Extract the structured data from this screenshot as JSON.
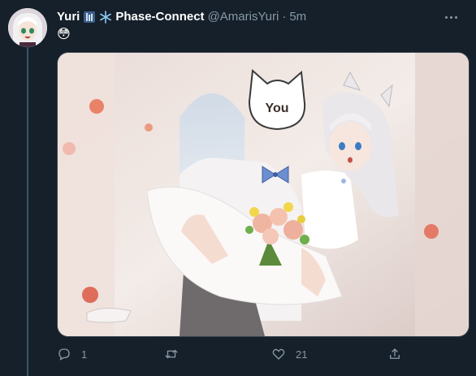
{
  "tweet": {
    "display_name": "Yuri",
    "affiliation_badges": [
      "building-icon",
      "snowflake-icon"
    ],
    "affiliation": "Phase-Connect",
    "handle": "@AmarisYuri",
    "separator": "·",
    "timestamp": "5m",
    "text": "😳",
    "media": {
      "sign_text": "You"
    }
  },
  "actions": {
    "reply_count": "1",
    "retweet_count": "",
    "like_count": "21"
  },
  "colors": {
    "background": "#15202b",
    "secondary_text": "#8899a6",
    "border": "#38444d"
  }
}
